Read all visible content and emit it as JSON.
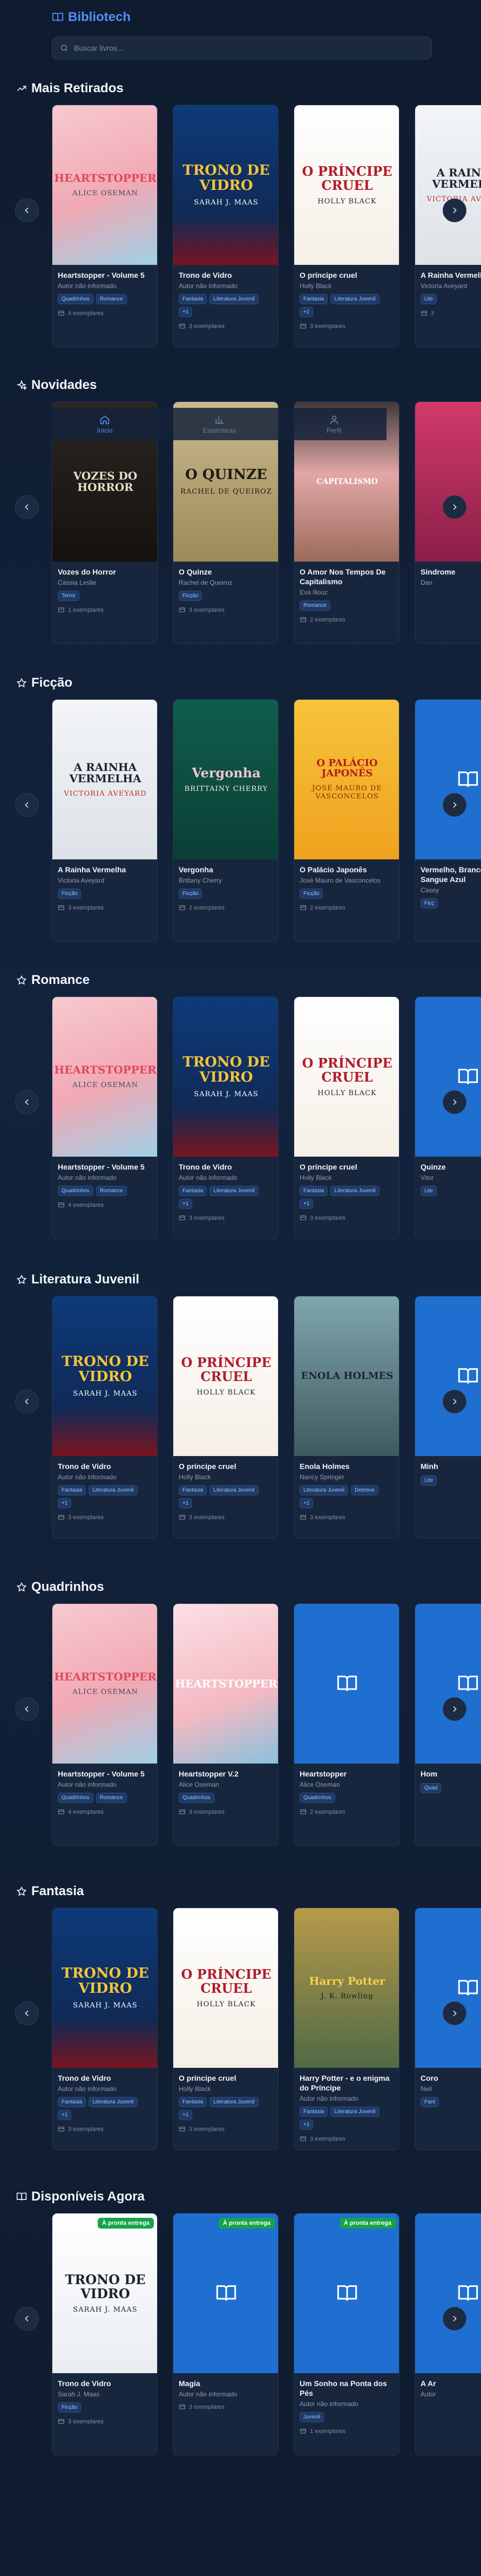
{
  "app": {
    "title": "Bibliotech"
  },
  "search": {
    "placeholder": "Buscar livros..."
  },
  "tabs": [
    {
      "label": "Início",
      "icon": "home-icon"
    },
    {
      "label": "Estatísticas",
      "icon": "bar-chart-icon"
    },
    {
      "label": "Perfil",
      "icon": "user-icon"
    }
  ],
  "copies_suffix": "exemplares",
  "sections": [
    {
      "title": "Mais Retirados",
      "icon": "trending-up-icon",
      "books": [
        {
          "title": "Heartstopper - Volume 5",
          "author": "Autor não informado",
          "tags": [
            "Quadrinhos",
            "Romance"
          ],
          "copies": "4 exemplares",
          "cover": "heartstopper",
          "cover_title": "HEARTSTOPPER",
          "cover_author": "ALICE OSEMAN"
        },
        {
          "title": "Trono de Vidro",
          "author": "Autor não informado",
          "tags": [
            "Fantasia",
            "Literatura Juvenil",
            "+1"
          ],
          "copies": "3 exemplares",
          "cover": "trono",
          "cover_title": "TRONO DE VIDRO",
          "cover_author": "SARAH J. MAAS"
        },
        {
          "title": "O príncipe cruel",
          "author": "Holly Black",
          "tags": [
            "Fantasia",
            "Literatura Juvenil",
            "+1"
          ],
          "copies": "3 exemplares",
          "cover": "principe",
          "cover_title": "O PRÍNCIPE CRUEL",
          "cover_author": "HOLLY BLACK"
        },
        {
          "title": "A Rainha Vermelha",
          "author": "Victoria Aveyard",
          "tags": [
            "Lite"
          ],
          "copies": "3",
          "cover": "rainha",
          "cover_title": "A RAINHA VERMELHA",
          "cover_author": "VICTORIA AVEYARD"
        }
      ]
    },
    {
      "title": "Novidades",
      "icon": "sparkles-icon",
      "books": [
        {
          "title": "Vozes do Horror",
          "author": "Cássia Leslie",
          "tags": [
            "Terror"
          ],
          "copies": "1 exemplares",
          "cover": "vozes",
          "cover_title": "VOZES DO HORROR",
          "cover_author": ""
        },
        {
          "title": "O Quinze",
          "author": "Rachel de Queiroz",
          "tags": [
            "Ficção"
          ],
          "copies": "3 exemplares",
          "cover": "quinze",
          "cover_title": "O QUINZE",
          "cover_author": "RACHEL DE QUEIROZ"
        },
        {
          "title": "O Amor Nos Tempos De Capitalismo",
          "author": "Eva Illouz",
          "tags": [
            "Romance"
          ],
          "copies": "2 exemplares",
          "cover": "capitalismo",
          "cover_title": "CAPITALISMO",
          "cover_author": ""
        },
        {
          "title": "Sindrome",
          "author": "Dan",
          "tags": [],
          "copies": "",
          "cover": "pink",
          "cover_title": "",
          "cover_author": ""
        }
      ]
    },
    {
      "title": "Ficção",
      "icon": "star-icon",
      "books": [
        {
          "title": "A Rainha Vermelha",
          "author": "Victoria Aveyard",
          "tags": [
            "Ficção"
          ],
          "copies": "3 exemplares",
          "cover": "rainha",
          "cover_title": "A RAINHA VERMELHA",
          "cover_author": "VICTORIA AVEYARD"
        },
        {
          "title": "Vergonha",
          "author": "Brittany Cherry",
          "tags": [
            "Ficção"
          ],
          "copies": "2 exemplares",
          "cover": "vergonha",
          "cover_title": "Vergonha",
          "cover_author": "BRITTAINY CHERRY"
        },
        {
          "title": "O Palácio Japonês",
          "author": "José Mauro de Vasconcelos",
          "tags": [
            "Ficção"
          ],
          "copies": "2 exemplares",
          "cover": "palacio",
          "cover_title": "O PALÁCIO JAPONÊS",
          "cover_author": "JOSÉ MAURO DE VASCONCELOS"
        },
        {
          "title": "Vermelho, Branco e Sangue Azul",
          "author": "Casey",
          "tags": [
            "Ficç"
          ],
          "copies": "",
          "cover": "placeholder",
          "cover_title": "",
          "cover_author": ""
        }
      ]
    },
    {
      "title": "Romance",
      "icon": "star-icon",
      "books": [
        {
          "title": "Heartstopper - Volume 5",
          "author": "Autor não informado",
          "tags": [
            "Quadrinhos",
            "Romance"
          ],
          "copies": "4 exemplares",
          "cover": "heartstopper",
          "cover_title": "HEARTSTOPPER",
          "cover_author": "ALICE OSEMAN"
        },
        {
          "title": "Trono de Vidro",
          "author": "Autor não informado",
          "tags": [
            "Fantasia",
            "Literatura Juvenil",
            "+1"
          ],
          "copies": "3 exemplares",
          "cover": "trono",
          "cover_title": "TRONO DE VIDRO",
          "cover_author": "SARAH J. MAAS"
        },
        {
          "title": "O príncipe cruel",
          "author": "Holly Black",
          "tags": [
            "Fantasia",
            "Literatura Juvenil",
            "+1"
          ],
          "copies": "3 exemplares",
          "cover": "principe",
          "cover_title": "O PRÍNCIPE CRUEL",
          "cover_author": "HOLLY BLACK"
        },
        {
          "title": "Quinze",
          "author": "Vitor",
          "tags": [
            "Lite"
          ],
          "copies": "",
          "cover": "placeholder",
          "cover_title": "",
          "cover_author": ""
        }
      ]
    },
    {
      "title": "Literatura Juvenil",
      "icon": "star-icon",
      "books": [
        {
          "title": "Trono de Vidro",
          "author": "Autor não informado",
          "tags": [
            "Fantasia",
            "Literatura Juvenil",
            "+1"
          ],
          "copies": "3 exemplares",
          "cover": "trono",
          "cover_title": "TRONO DE VIDRO",
          "cover_author": "SARAH J. MAAS"
        },
        {
          "title": "O príncipe cruel",
          "author": "Holly Black",
          "tags": [
            "Fantasia",
            "Literatura Juvenil",
            "+1"
          ],
          "copies": "3 exemplares",
          "cover": "principe",
          "cover_title": "O PRÍNCIPE CRUEL",
          "cover_author": "HOLLY BLACK"
        },
        {
          "title": "Enola Holmes",
          "author": "Nancy Springer",
          "tags": [
            "Literatura Juvenil",
            "Detetive",
            "+1"
          ],
          "copies": "3 exemplares",
          "cover": "enola",
          "cover_title": "ENOLA HOLMES",
          "cover_author": ""
        },
        {
          "title": "Minh",
          "author": "",
          "tags": [
            "Lite"
          ],
          "copies": "",
          "cover": "placeholder",
          "cover_title": "",
          "cover_author": ""
        }
      ]
    },
    {
      "title": "Quadrinhos",
      "icon": "star-icon",
      "books": [
        {
          "title": "Heartstopper - Volume 5",
          "author": "Autor não informado",
          "tags": [
            "Quadrinhos",
            "Romance"
          ],
          "copies": "4 exemplares",
          "cover": "heartstopper",
          "cover_title": "HEARTSTOPPER",
          "cover_author": "ALICE OSEMAN"
        },
        {
          "title": "Heartstopper V.2",
          "author": "Alice Oseman",
          "tags": [
            "Quadrinhos"
          ],
          "copies": "3 exemplares",
          "cover": "heartstopper2",
          "cover_title": "HEARTSTOPPER",
          "cover_author": ""
        },
        {
          "title": "Heartstopper",
          "author": "Alice Oseman",
          "tags": [
            "Quadrinhos"
          ],
          "copies": "2 exemplares",
          "cover": "placeholder",
          "cover_title": "",
          "cover_author": ""
        },
        {
          "title": "Hom",
          "author": "",
          "tags": [
            "Quad"
          ],
          "copies": "",
          "cover": "placeholder",
          "cover_title": "",
          "cover_author": ""
        }
      ]
    },
    {
      "title": "Fantasia",
      "icon": "star-icon",
      "books": [
        {
          "title": "Trono de Vidro",
          "author": "Autor não informado",
          "tags": [
            "Fantasia",
            "Literatura Juvenil",
            "+1"
          ],
          "copies": "3 exemplares",
          "cover": "trono",
          "cover_title": "TRONO DE VIDRO",
          "cover_author": "SARAH J. MAAS"
        },
        {
          "title": "O príncipe cruel",
          "author": "Holly Black",
          "tags": [
            "Fantasia",
            "Literatura Juvenil",
            "+1"
          ],
          "copies": "3 exemplares",
          "cover": "principe",
          "cover_title": "O PRÍNCIPE CRUEL",
          "cover_author": "HOLLY BLACK"
        },
        {
          "title": "Harry Potter - e o enigma do Príncipe",
          "author": "Autor não informado",
          "tags": [
            "Fantasia",
            "Literatura Juvenil",
            "+1"
          ],
          "copies": "3 exemplares",
          "cover": "harry",
          "cover_title": "Harry Potter",
          "cover_author": "J. K. Rowling"
        },
        {
          "title": "Coro",
          "author": "Neil",
          "tags": [
            "Fant"
          ],
          "copies": "",
          "cover": "placeholder",
          "cover_title": "",
          "cover_author": ""
        }
      ]
    },
    {
      "title": "Disponíveis Agora",
      "icon": "book-open-icon",
      "books": [
        {
          "title": "Trono de Vidro",
          "author": "Sarah J. Maas",
          "tags": [
            "Ficção"
          ],
          "copies": "3 exemplares",
          "cover": "trono-white",
          "cover_title": "TRONO DE VIDRO",
          "cover_author": "SARAH J. MAAS",
          "badge": "À pronta entrega"
        },
        {
          "title": "Magia",
          "author": "Autor não informado",
          "tags": [],
          "copies": "3 exemplares",
          "cover": "placeholder",
          "cover_title": "",
          "cover_author": "",
          "badge": "À pronta entrega"
        },
        {
          "title": "Um Sonho na Ponta dos Pés",
          "author": "Autor não informado",
          "tags": [
            "Juvenil"
          ],
          "copies": "1 exemplares",
          "cover": "placeholder",
          "cover_title": "",
          "cover_author": "",
          "badge": "À pronta entrega"
        },
        {
          "title": "A Ar",
          "author": "Autor",
          "tags": [],
          "copies": "",
          "cover": "placeholder",
          "cover_title": "",
          "cover_author": ""
        }
      ]
    }
  ]
}
